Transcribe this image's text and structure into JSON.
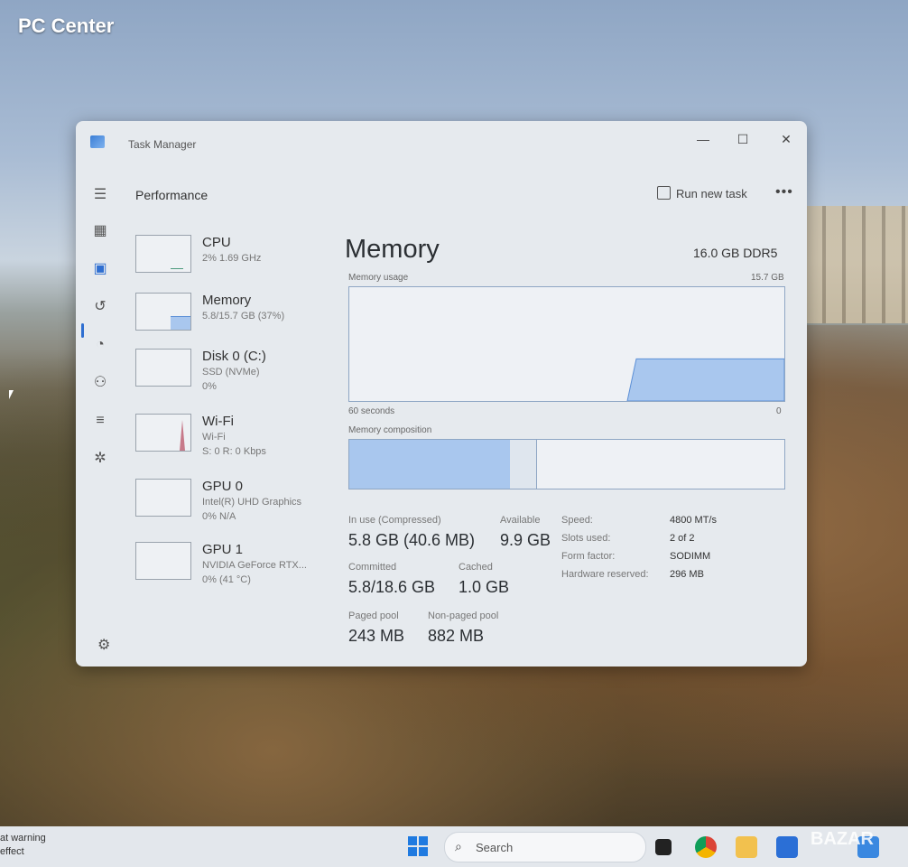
{
  "watermark": "PC Center",
  "window": {
    "title": "Task Manager",
    "buttons": {
      "minimize": "—",
      "maximize": "☐",
      "close": "✕"
    }
  },
  "header": {
    "section": "Performance",
    "run_new_task": "Run new task",
    "more": "•••"
  },
  "sidebar_items": [
    {
      "name": "CPU",
      "sub": "2% 1.69 GHz"
    },
    {
      "name": "Memory",
      "sub": "5.8/15.7 GB (37%)"
    },
    {
      "name": "Disk 0 (C:)",
      "sub1": "SSD (NVMe)",
      "sub2": "0%"
    },
    {
      "name": "Wi-Fi",
      "sub1": "Wi-Fi",
      "sub2": "S: 0 R: 0 Kbps"
    },
    {
      "name": "GPU 0",
      "sub1": "Intel(R) UHD Graphics",
      "sub2": "0% N/A"
    },
    {
      "name": "GPU 1",
      "sub1": "NVIDIA GeForce RTX...",
      "sub2": "0% (41 °C)"
    }
  ],
  "main": {
    "title": "Memory",
    "spec": "16.0 GB DDR5",
    "usage_label": "Memory usage",
    "usage_max": "15.7 GB",
    "time_left": "60 seconds",
    "time_right": "0",
    "composition_label": "Memory composition",
    "stats": {
      "in_use_label": "In use (Compressed)",
      "in_use_value": "5.8 GB (40.6 MB)",
      "available_label": "Available",
      "available_value": "9.9 GB",
      "committed_label": "Committed",
      "committed_value": "5.8/18.6 GB",
      "cached_label": "Cached",
      "cached_value": "1.0 GB",
      "paged_label": "Paged pool",
      "paged_value": "243 MB",
      "nonpaged_label": "Non-paged pool",
      "nonpaged_value": "882 MB"
    },
    "details": [
      {
        "label": "Speed:",
        "value": "4800 MT/s"
      },
      {
        "label": "Slots used:",
        "value": "2 of 2"
      },
      {
        "label": "Form factor:",
        "value": "SODIMM"
      },
      {
        "label": "Hardware reserved:",
        "value": "296 MB"
      }
    ]
  },
  "composition": {
    "in_use_fraction": 0.37,
    "modified_fraction": 0.06
  },
  "usage_level_fraction": 0.37,
  "taskbar": {
    "notice_line1": "at warning",
    "notice_line2": "effect",
    "search_placeholder": "Search"
  },
  "watermark_br": "BAZAR",
  "colors": {
    "accent": "#2f6fd1",
    "memory_fill": "#a9c7ee",
    "memory_line": "#5b8fd6"
  }
}
